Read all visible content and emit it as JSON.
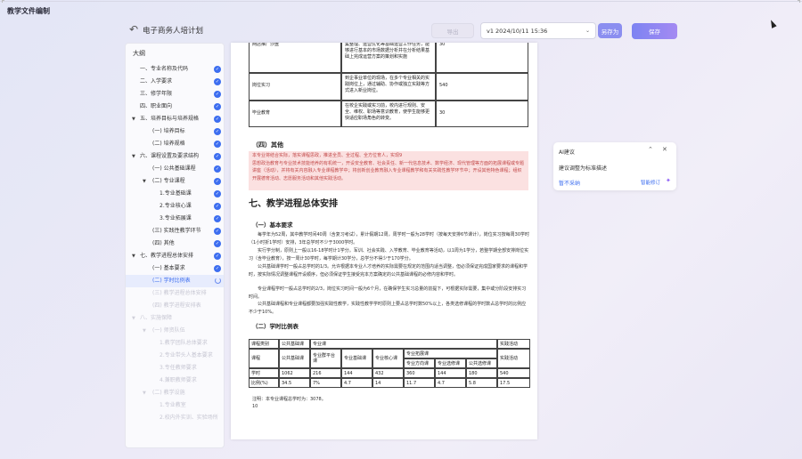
{
  "app": {
    "title": "教学文件编制"
  },
  "header": {
    "doc_title": "电子商务人培计划",
    "export_label": "导出",
    "version_value": "v1 2024/10/11 15:36",
    "save_as_label": "另存为",
    "save_label": "保存"
  },
  "sidebar": {
    "heading": "大纲",
    "items": [
      {
        "label": "一、专业名称及代码"
      },
      {
        "label": "二、入学要求"
      },
      {
        "label": "三、修学年限"
      },
      {
        "label": "四、职业面向"
      },
      {
        "label": "五、培养目标与培养规格"
      },
      {
        "label": "(一) 培养目标"
      },
      {
        "label": "(二) 培养规格"
      },
      {
        "label": "六、课程设置及要求结构"
      },
      {
        "label": "(一) 公共基础课程"
      },
      {
        "label": "(二) 专业课程"
      },
      {
        "label": "1.专业基础课"
      },
      {
        "label": "2.专业核心课"
      },
      {
        "label": "3.专业拓展课"
      },
      {
        "label": "(三) 实践性教学环节"
      },
      {
        "label": "(四) 其他"
      },
      {
        "label": "七、教学进程总体安排"
      },
      {
        "label": "(一) 基本要求"
      },
      {
        "label": "(二) 学时比例表"
      },
      {
        "label": "(三) 教学进程总体安排"
      },
      {
        "label": "(四) 教学进程安排表"
      },
      {
        "label": "八、实施保障"
      },
      {
        "label": "(一) 师资队伍"
      },
      {
        "label": "1.教学团队总体要求"
      },
      {
        "label": "2.专业带头人基本要求"
      },
      {
        "label": "3.专任教师要求"
      },
      {
        "label": "4.兼职教师要求"
      },
      {
        "label": "(二) 教学设施"
      },
      {
        "label": "1.专业教室"
      },
      {
        "label": "2.校内外实训、实验场所"
      }
    ]
  },
  "document": {
    "top_table": [
      {
        "name": "网店推广沙盘",
        "desc": "集整理、运营优化等基础运营工作任务，能够进行基本的市场数据分析并在分析结果基础上完成运营方案的策划和实施",
        "hours": "30"
      },
      {
        "name": "岗位实习",
        "desc": "到企事业单位的现场，在多个专业相关的实践岗位上，通过辅助、协作或独立实践等方式进入新业岗位。",
        "hours": "540"
      },
      {
        "name": "毕业教育",
        "desc": "在校企实践或实习前，校内进行规则、安全、维权、职场等意识教育，使学生能够更快适应职场角色的转变。",
        "hours": "30"
      }
    ],
    "section_other": "（四）其他",
    "highlight_text": "本专业将结合实际，落实课程思政，推进全员、全过程、全方位育人，实现9\n思想政治教育与专业技术技能培养的有机统一，开设安全教育、社会责任、新一代信息技术、数学经济、现代管理等方面的拓展课程或专题讲座（活动），并将有关内容融入专业课程教学中；将创新创业教育融入专业课程教学和有关实践性教学环节中；开设其他特色课程；组织开展德育活动、志愿服务活动和其他实践活动。",
    "section7": "七、教学进程总体安排",
    "sub1": "（一）基本要求",
    "para1": "每学年为52周，其中教学时间40周（含复习考试），累计假期12周，周学时一般为28学时（按每天安排6节课计），岗位实习按每周30学时（1小时折1学时）安排，3年总学时不少于3000学时。",
    "para2": "实行学分制，原则上一般以16-18学时计1学分。军训、社会实践、入学教育、毕业教育等活动，以1周为1学分，若整学期全部安排岗位实习（含毕业教育），按一周计30学时，每学期计30学分，总学分不得少于170学分。",
    "para3": "公共基础课学时一般占总学时的1/3。允许根据本专业人才培养的实际需要在规定的范围内适当调整，但必须保证完成国家要求的课程和学时，按实际情况调整课程开设顺序，但必须保证学生接受完本方案确定的公共基础课程的必修内容和学时。",
    "para4": "专业课程学时一般占总学时的2/3，岗位实习时间一般为6个月，在确保学生实习总量的前提下，可根据实际需要，集中或分阶段安排实习时间。",
    "para5": "公共基础课程和专业课程都要加强实践性教学，实践性教学学时原则上要占总学时数50%以上，各类选修课程的学时数占总学时的比例应不少于10%。",
    "sub2": "（二）学时比例表",
    "ratio_table": {
      "r1": [
        "课程类别",
        "公共基础课",
        "专业课",
        "实践活动"
      ],
      "r2": [
        "课程",
        "公共基础课",
        "专业群平台课",
        "专业基础课",
        "专业核心课",
        "专业拓展课",
        "实践活动"
      ],
      "r3": [
        "专业方向课",
        "专业选修课",
        "公共选修课"
      ],
      "hours": [
        "学时",
        "1062",
        "216",
        "144",
        "432",
        "360",
        "144",
        "180",
        "540"
      ],
      "ratio": [
        "比例(%)",
        "34.5",
        "7%",
        "4.7",
        "14",
        "11.7",
        "4.7",
        "5.8",
        "17.5"
      ]
    },
    "note": "注明：本专业课程总学时为：3078。",
    "note2": "10"
  },
  "ai_panel": {
    "title": "AI建议",
    "suggestion": "建议调整为标准描述",
    "reject": "暂不采纳",
    "smart_label": "智能修订"
  }
}
